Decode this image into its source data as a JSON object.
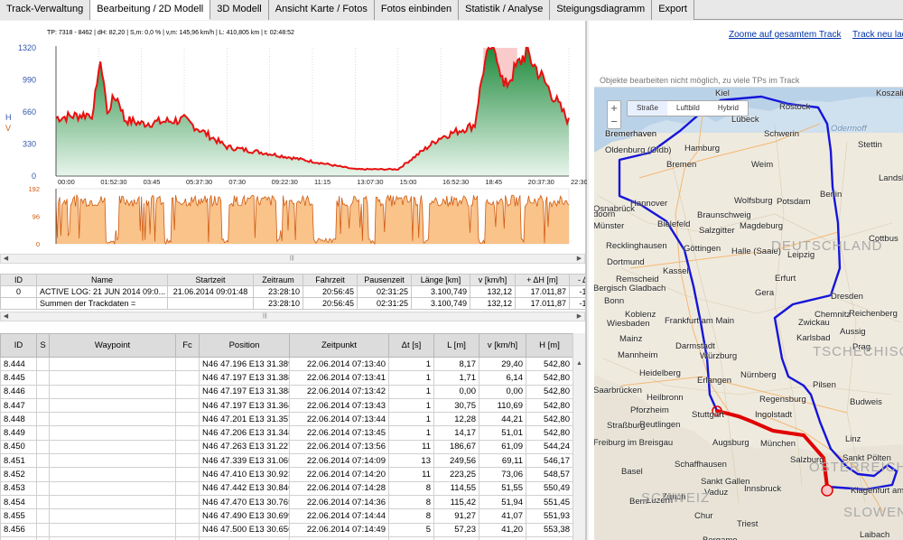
{
  "tabs": [
    "Track-Verwaltung",
    "Bearbeitung / 2D Modell",
    "3D Modell",
    "Ansicht Karte / Fotos",
    "Fotos einbinden",
    "Statistik / Analyse",
    "Steigungsdiagramm",
    "Export"
  ],
  "active_tab": 1,
  "chart": {
    "info": "TP: 7318 - 8462 | dH: 82,20 | S,m: 0,0 % | v,m: 145,96 km/h | L: 410,805 km | t: 02:48:52",
    "y_axis_label_h": "H",
    "y_axis_label_v": "V",
    "y_ticks": [
      "1320",
      "990",
      "660",
      "330",
      "0"
    ],
    "x_ticks": [
      "00:00",
      "01:52:30",
      "03:45",
      "05:37:30",
      "07:30",
      "09:22:30",
      "11:15",
      "13:07:30",
      "15:00",
      "16:52:30",
      "18:45",
      "20:37:30",
      "22:30"
    ],
    "v_ticks": [
      "192",
      "96",
      "0"
    ],
    "colors": {
      "line": "#e81010",
      "fill_top": "#1f8a3c",
      "fill_bottom": "#e8f5ec",
      "speed_line": "#d05a10",
      "speed_fill": "#f9c38a",
      "highlight": "#f4a0a0"
    }
  },
  "chart_data": {
    "type": "area",
    "title": "TP: 7318 - 8462 | dH: 82,20 | S,m: 0,0 % | v,m: 145,96 km/h | L: 410,805 km | t: 02:48:52",
    "xlabel": "",
    "ylabel": "H",
    "x": [
      "00:00",
      "01:52:30",
      "03:45",
      "05:37:30",
      "07:30",
      "09:22:30",
      "11:15",
      "13:07:30",
      "15:00",
      "16:52:30",
      "18:45",
      "20:37:30",
      "22:30"
    ],
    "ylim": [
      0,
      1320
    ],
    "series": [
      {
        "values": [
          600,
          650,
          540,
          580,
          300,
          230,
          150,
          70,
          70,
          400,
          560,
          1280,
          560
        ]
      }
    ],
    "highlight_range": [
      "18:45",
      "21:10"
    ]
  },
  "summary": {
    "headers": [
      "ID",
      "Name",
      "Startzeit",
      "Zeitraum",
      "Fahrzeit",
      "Pausenzeit",
      "Länge [km]",
      "v [km/h]",
      "+ ΔH [m]",
      "- Δ"
    ],
    "rows": [
      [
        "0",
        "ACTIVE LOG: 21 JUN 2014 09:0...",
        "21.06.2014 09:01:48",
        "23:28:10",
        "20:56:45",
        "02:31:25",
        "3.100,749",
        "132,12",
        "17.011,87",
        "-17."
      ],
      [
        "",
        "Summen der Trackdaten =",
        "",
        "23:28:10",
        "20:56:45",
        "02:31:25",
        "3.100,749",
        "132,12",
        "17.011,87",
        "-17."
      ]
    ]
  },
  "waypoints": {
    "headers": [
      "ID",
      "S",
      "Waypoint",
      "Fc",
      "Position",
      "Zeitpunkt",
      "Δt [s]",
      "L [m]",
      "v [km/h]",
      "H [m]"
    ],
    "rows": [
      [
        "8.444",
        "",
        "",
        "",
        "N46 47.196 E13 31.389",
        "22.06.2014 07:13:40",
        "1",
        "8,17",
        "29,40",
        "542,80"
      ],
      [
        "8.445",
        "",
        "",
        "",
        "N46 47.197 E13 31.388",
        "22.06.2014 07:13:41",
        "1",
        "1,71",
        "6,14",
        "542,80"
      ],
      [
        "8.446",
        "",
        "",
        "",
        "N46 47.197 E13 31.388",
        "22.06.2014 07:13:42",
        "1",
        "0,00",
        "0,00",
        "542,80"
      ],
      [
        "8.447",
        "",
        "",
        "",
        "N46 47.197 E13 31.364",
        "22.06.2014 07:13:43",
        "1",
        "30,75",
        "110,69",
        "542,80"
      ],
      [
        "8.448",
        "",
        "",
        "",
        "N46 47.201 E13 31.357",
        "22.06.2014 07:13:44",
        "1",
        "12,28",
        "44,21",
        "542,80"
      ],
      [
        "8.449",
        "",
        "",
        "",
        "N46 47.206 E13 31.348",
        "22.06.2014 07:13:45",
        "1",
        "14,17",
        "51,01",
        "542,80"
      ],
      [
        "8.450",
        "",
        "",
        "",
        "N46 47.263 E13 31.227",
        "22.06.2014 07:13:56",
        "11",
        "186,67",
        "61,09",
        "544,24"
      ],
      [
        "8.451",
        "",
        "",
        "",
        "N46 47.339 E13 31.065",
        "22.06.2014 07:14:09",
        "13",
        "249,56",
        "69,11",
        "546,17"
      ],
      [
        "8.452",
        "",
        "",
        "",
        "N46 47.410 E13 30.923",
        "22.06.2014 07:14:20",
        "11",
        "223,25",
        "73,06",
        "548,57"
      ],
      [
        "8.453",
        "",
        "",
        "",
        "N46 47.442 E13 30.846",
        "22.06.2014 07:14:28",
        "8",
        "114,55",
        "51,55",
        "550,49"
      ],
      [
        "8.454",
        "",
        "",
        "",
        "N46 47.470 E13 30.765",
        "22.06.2014 07:14:36",
        "8",
        "115,42",
        "51,94",
        "551,45"
      ],
      [
        "8.455",
        "",
        "",
        "",
        "N46 47.490 E13 30.699",
        "22.06.2014 07:14:44",
        "8",
        "91,27",
        "41,07",
        "551,93"
      ],
      [
        "8.456",
        "",
        "",
        "",
        "N46 47.500 E13 30.656",
        "22.06.2014 07:14:49",
        "5",
        "57,23",
        "41,20",
        "553,38"
      ],
      [
        "8.457",
        "",
        "",
        "",
        "N46 47.501 E13 30.653",
        "22.06.2014 07:14:50",
        "1",
        "4,54",
        "16,36",
        "552,90"
      ]
    ]
  },
  "map": {
    "link_zoom": "Zoome auf gesamtem Track",
    "link_reload": "Track neu laden",
    "message": "Objekte bearbeiten nicht möglich, zu viele TPs im Track",
    "layers": [
      "Straße",
      "Luftbild",
      "Hybrid"
    ],
    "active_layer": "Straße",
    "labels": [
      "Kiel",
      "Rostock",
      "Koszalin",
      "Lübeck",
      "Schwerin",
      "Bremerhaven",
      "Hamburg",
      "Stettin",
      "Oldenburg (Oldb)",
      "Bremen",
      "Landsberg",
      "Berlin",
      "Potsdam",
      "Wolfsburg",
      "Hannover",
      "Osnabrück",
      "Bielefeld",
      "Braunschweig",
      "Salzgitter",
      "Magdeburg",
      "Münster",
      "Recklinghausen",
      "Cottbus",
      "Dortmund",
      "Kassel",
      "Göttingen",
      "Halle (Saale)",
      "Leipzig",
      "Remscheid",
      "Bergisch Gladbach",
      "Bonn",
      "Koblenz",
      "Erfurt",
      "Gera",
      "Dresden",
      "Chemnitz",
      "Zwickau",
      "Reichenberg",
      "Wiesbaden",
      "Frankfurt am Main",
      "Aussig",
      "Karlsbad",
      "Prag",
      "Mainz",
      "Darmstadt",
      "Würzburg",
      "Mannheim",
      "Heidelberg",
      "Erlangen",
      "Nürnberg",
      "Pilsen",
      "Saarbrücken",
      "Heilbronn",
      "Pforzheim",
      "Stuttgart",
      "Reutlingen",
      "Regensburg",
      "Ingolstadt",
      "Budweis",
      "Straßburg",
      "Augsburg",
      "München",
      "Linz",
      "Sankt Pölten",
      "Freiburg im Breisgau",
      "Salzburg",
      "Basel",
      "Schaffhausen",
      "Zürich",
      "Sankt Gallen",
      "Vaduz",
      "Innsbruck",
      "Bern",
      "Luzern",
      "Chur",
      "Klagenfurt am Wörthersee",
      "Triest",
      "Laibach",
      "Bergamo",
      "Deutschland",
      "Tschechische",
      "Österreich",
      "Schweiz",
      "Slowen",
      "doorn",
      "Weim",
      "Bremerhaven"
    ],
    "country_labels": {
      "de": "DEUTSCHLAND",
      "cz": "TSCHECHISCHE",
      "at": "ÖSTERREICH",
      "ch": "SCHWEIZ",
      "si": "SLOWEN"
    },
    "sea_label": "Odermoff",
    "colors": {
      "route": "#1515d8",
      "highlight": "#e00000",
      "marker": "#e00000"
    }
  }
}
